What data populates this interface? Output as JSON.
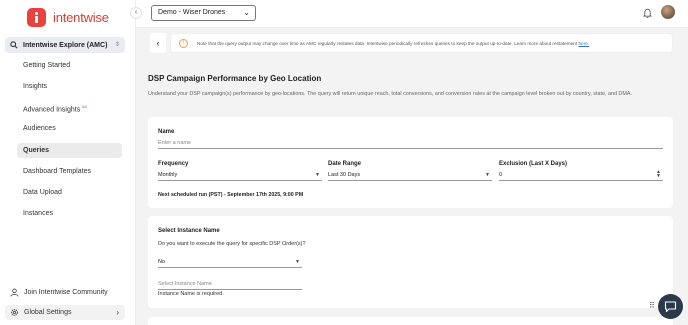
{
  "app": {
    "logo_text": "intentwise"
  },
  "sidebar": {
    "collapse_glyph": "‹",
    "module_label": "Intentwise Explore (AMC)",
    "items": [
      {
        "label": "Getting Started"
      },
      {
        "label": "Insights"
      },
      {
        "label": "Advanced Insights",
        "badge": "5A"
      },
      {
        "label": "Audiences"
      },
      {
        "label": "Queries",
        "active": true
      },
      {
        "label": "Dashboard Templates"
      },
      {
        "label": "Data Upload"
      },
      {
        "label": "Instances"
      }
    ],
    "community_label": "Join Intentwise Community",
    "settings_label": "Global Settings"
  },
  "topbar": {
    "account_value": "Demo - Wiser Drones",
    "bell_icon": "bell-icon",
    "avatar_icon": "user-avatar"
  },
  "notice": {
    "back_glyph": "‹",
    "warn_glyph": "!",
    "text": "Note that the query output may change over time as AMC regularly restates data. Intentwise periodically refreshes queries to keep the output up-to-date. Learn more about restatement",
    "link_text": "here."
  },
  "page": {
    "title": "DSP Campaign Performance by Geo Location",
    "description": "Understand your DSP campaign(s) performance by geo-locations. The query will return unique reach, total conversions, and conversion rates at the campaign level broken out by country, state, and DMA."
  },
  "form": {
    "name_label": "Name",
    "name_placeholder": "Enter a name",
    "frequency_label": "Frequency",
    "frequency_value": "Monthly",
    "date_range_label": "Date Range",
    "date_range_value": "Last 30 Days",
    "exclusion_label": "Exclusion (Last X Days)",
    "exclusion_value": "0",
    "next_run": "Next scheduled run (PST) - September 17th 2025, 9:00 PM"
  },
  "instance": {
    "title": "Select Instance Name",
    "question": "Do you want to execute the query for specific DSP Order(s)?",
    "dsp_order_value": "No",
    "instance_placeholder": "Select Instance Name",
    "required_msg": "Instance Name is required."
  },
  "colors": {
    "brand": "#e8423f",
    "link": "#3b6fc4",
    "warn": "#e0a640",
    "chat": "#2b3a4a"
  }
}
